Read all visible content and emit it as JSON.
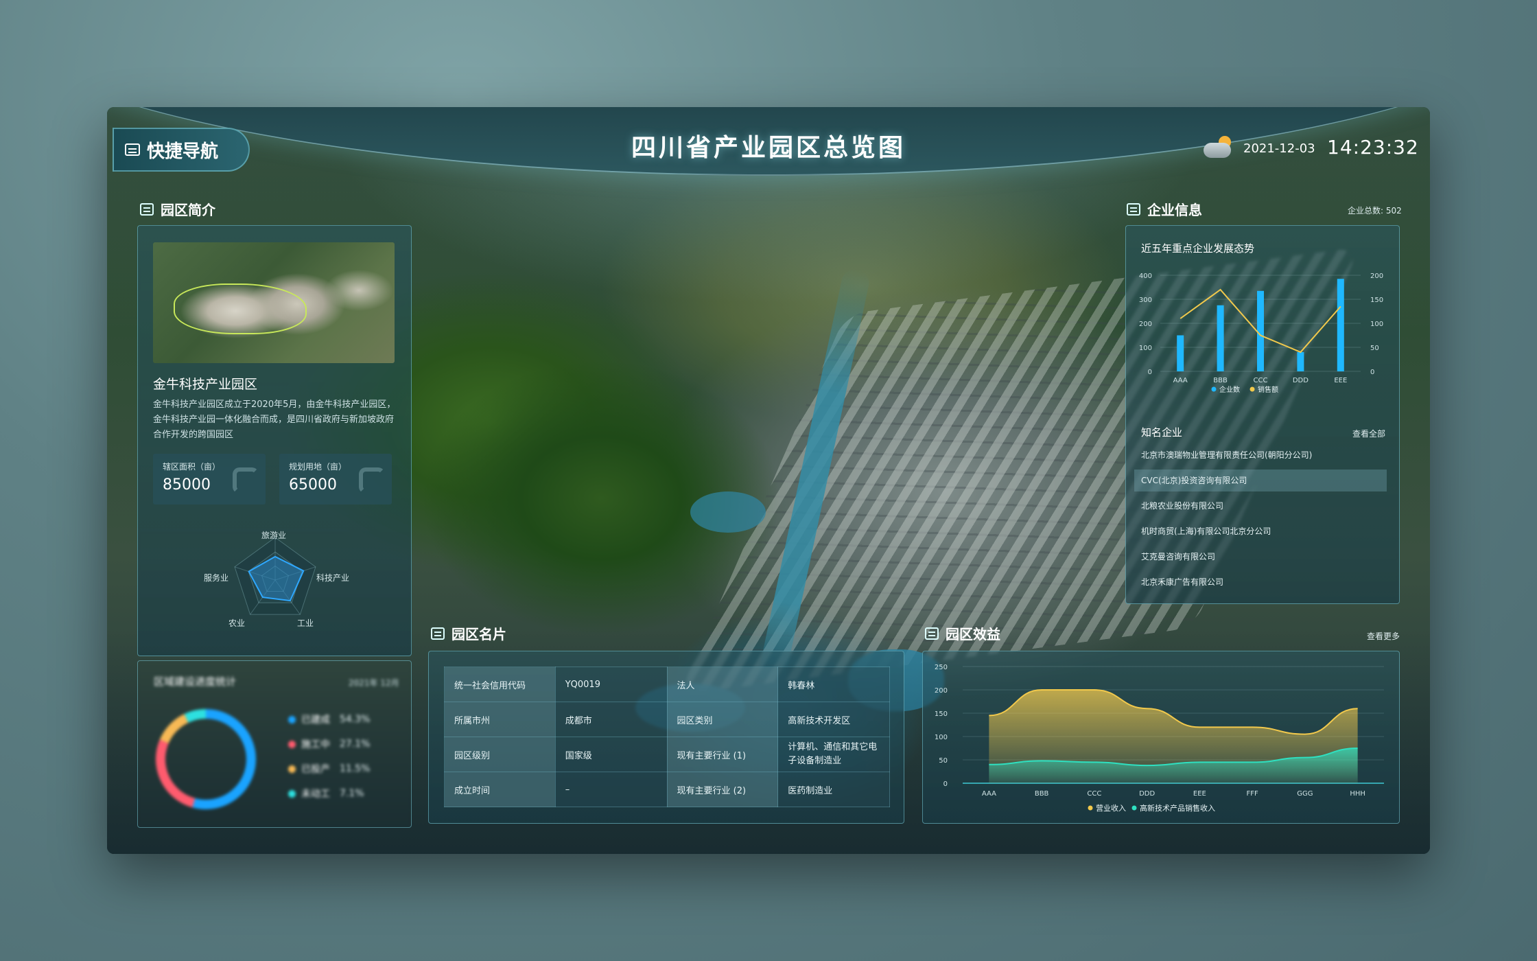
{
  "header": {
    "nav_label": "快捷导航",
    "title": "四川省产业园区总览图",
    "date": "2021-12-03",
    "time": "14:23:32",
    "weather_icon": "partly-cloudy-icon"
  },
  "intro": {
    "heading": "园区简介",
    "park_name": "金牛科技产业园区",
    "description": "金牛科技产业园区成立于2020年5月，由金牛科技产业园区，金牛科技产业园一体化融合而成，是四川省政府与新加坡政府合作开发的跨国园区",
    "stats": [
      {
        "label": "辖区面积（亩）",
        "value": "85000"
      },
      {
        "label": "规划用地（亩）",
        "value": "65000"
      }
    ],
    "radar": {
      "axes": [
        "旅游业",
        "科技产业",
        "工业",
        "农业",
        "服务业"
      ],
      "values": [
        0.55,
        0.7,
        0.6,
        0.5,
        0.65
      ]
    }
  },
  "progress": {
    "title": "区域建设进度统计",
    "period": "2021年 12月",
    "items": [
      {
        "label": "已建成",
        "pct": "54.3%",
        "value": 54.3,
        "color": "#1aa3ff"
      },
      {
        "label": "施工中",
        "pct": "27.1%",
        "value": 27.1,
        "color": "#ff5b6e"
      },
      {
        "label": "已投产",
        "pct": "11.5%",
        "value": 11.5,
        "color": "#f7b955"
      },
      {
        "label": "未动工",
        "pct": "7.1%",
        "value": 7.1,
        "color": "#2de0e0"
      }
    ]
  },
  "enterprise": {
    "heading": "企业信息",
    "total": "企业总数: 502",
    "trend_title": "近五年重点企业发展态势",
    "famous_title": "知名企业",
    "view_all": "查看全部",
    "companies": [
      "北京市澳瑞物业管理有限责任公司(朝阳分公司)",
      "CVC(北京)投资咨询有限公司",
      "北粮农业股份有限公司",
      "机时商贸(上海)有限公司北京分公司",
      "艾克曼咨询有限公司",
      "北京禾康广告有限公司"
    ],
    "active_index": 1
  },
  "card": {
    "heading": "园区名片",
    "rows": [
      [
        "统一社会信用代码",
        "YQ0019",
        "法人",
        "韩春林"
      ],
      [
        "所属市州",
        "成都市",
        "园区类别",
        "高新技术开发区"
      ],
      [
        "园区级别",
        "国家级",
        "现有主要行业 (1)",
        "计算机、通信和其它电子设备制造业"
      ],
      [
        "成立时间",
        "–",
        "现有主要行业 (2)",
        "医药制造业"
      ]
    ]
  },
  "benefit": {
    "heading": "园区效益",
    "more": "查看更多"
  },
  "chart_data": [
    {
      "type": "bar",
      "title": "近五年重点企业发展态势",
      "categories": [
        "AAA",
        "BBB",
        "CCC",
        "DDD",
        "EEE"
      ],
      "ylim_left": [
        0,
        400
      ],
      "ylim_right": [
        0,
        200
      ],
      "yticks_left": [
        0,
        100,
        200,
        300,
        400
      ],
      "yticks_right": [
        0,
        50,
        100,
        150,
        200
      ],
      "series": [
        {
          "name": "企业数",
          "kind": "bar",
          "axis": "left",
          "color": "#1fb8ff",
          "values": [
            150,
            275,
            335,
            80,
            385
          ]
        },
        {
          "name": "销售额",
          "kind": "line",
          "axis": "right",
          "color": "#f2c94c",
          "values": [
            110,
            170,
            75,
            40,
            135
          ]
        }
      ],
      "legend": "bottom"
    },
    {
      "type": "area",
      "categories": [
        "AAA",
        "BBB",
        "CCC",
        "DDD",
        "EEE",
        "FFF",
        "GGG",
        "HHH"
      ],
      "ylim": [
        0,
        250
      ],
      "yticks": [
        0,
        50,
        100,
        150,
        200,
        250
      ],
      "series": [
        {
          "name": "营业收入",
          "color": "#f2c94c",
          "values": [
            145,
            200,
            200,
            160,
            120,
            120,
            105,
            160
          ]
        },
        {
          "name": "高新技术产品销售收入",
          "color": "#2fe0c0",
          "values": [
            40,
            48,
            45,
            38,
            45,
            45,
            55,
            75
          ]
        }
      ],
      "legend": "bottom"
    }
  ]
}
